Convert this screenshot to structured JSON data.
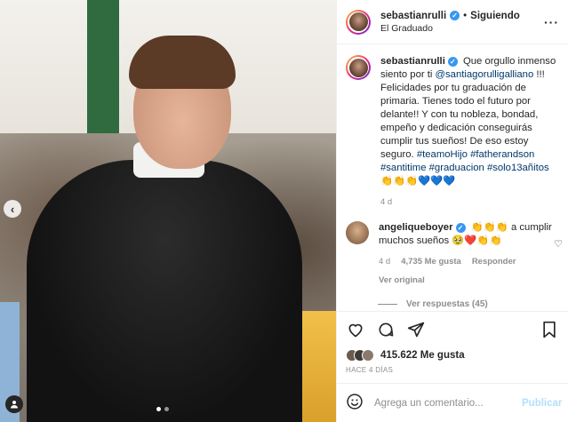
{
  "post": {
    "username": "sebastianrulli",
    "follow_label": "Siguiendo",
    "location": "El Graduado"
  },
  "caption": {
    "username": "sebastianrulli",
    "text_1": "Que orgullo inmenso siento por ti",
    "mention": "@santiagorulligalliano",
    "text_2": "!!! Felicidades por tu graduación de primaria. Tienes todo el futuro por delante!! Y con tu nobleza, bondad, empeño y dedicación conseguirás cumplir tus sueños! De eso estoy seguro.",
    "hashtags": "#teamoHijo #fatherandson #santitime #graduacion #solo13añitos",
    "emojis": "👏👏👏💙💙💙",
    "time": "4 d"
  },
  "comment": {
    "username": "angeliqueboyer",
    "emojis_1": "👏👏👏",
    "text": "a cumplir muchos sueños",
    "emojis_2": "🥹❤️👏👏",
    "time": "4 d",
    "likes": "4,735 Me gusta",
    "reply_label": "Responder",
    "see_original": "Ver original",
    "view_replies": "Ver respuestas (45)"
  },
  "likes": {
    "count": "415.622 Me gusta",
    "time_ago": "HACE 4 DÍAS"
  },
  "add_comment": {
    "placeholder": "Agrega un comentario...",
    "post_label": "Publicar"
  },
  "colors": {
    "verified": "#3897f0",
    "link": "#00376b",
    "muted": "#8e8e8e",
    "post_disabled": "#b2dffc"
  },
  "icons": [
    "chevron-left-icon",
    "user-tag-icon",
    "more-icon",
    "heart-icon",
    "comment-icon",
    "share-icon",
    "bookmark-icon",
    "emoji-icon",
    "verified-icon"
  ]
}
